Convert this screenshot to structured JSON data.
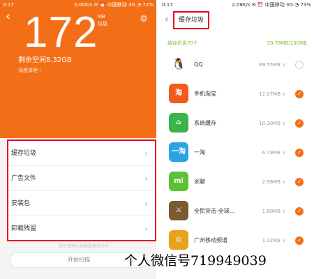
{
  "left": {
    "status": {
      "time": "0:17",
      "right": "0.00K/s ✉ ⏰ 中国移动 3G ◔ 72%"
    },
    "storage": {
      "value": "172",
      "unit": "MB",
      "unit_label": "垃圾",
      "remaining": "剩余空间8.32GB",
      "deep_clean": "深度清理 ›"
    },
    "menu": [
      {
        "label": "缓存垃圾"
      },
      {
        "label": "广告文件"
      },
      {
        "label": "安装包"
      },
      {
        "label": "卸载残留"
      }
    ],
    "hint": "部分清理大项需要等待文件",
    "start_button": "开始扫描"
  },
  "right": {
    "status": {
      "time": "0:17",
      "right": "2.08K/s ✉ ⏰ 中国移动 3G ◔ 73%"
    },
    "title": "缓存垃圾",
    "summary_left": "缓存垃圾70个",
    "summary_right": "39.78MB/130MB",
    "apps": [
      {
        "name": "QQ",
        "size": "89.55MB",
        "checked": false,
        "icon": "qq-icon",
        "color": "#ffffff",
        "glyph": "🐧"
      },
      {
        "name": "手机淘宝",
        "size": "12.07MB",
        "checked": true,
        "icon": "taobao-icon",
        "color": "#f35b1a",
        "glyph": "淘"
      },
      {
        "name": "系统缓存",
        "size": "10.30MB",
        "checked": true,
        "icon": "system-cache-icon",
        "color": "#39b54a",
        "glyph": "⌂"
      },
      {
        "name": "一淘",
        "size": "6.79MB",
        "checked": true,
        "icon": "yitao-icon",
        "color": "#2aa4e2",
        "glyph": "一淘"
      },
      {
        "name": "米聊",
        "size": "2.96MB",
        "checked": true,
        "icon": "miliao-icon",
        "color": "#5bc236",
        "glyph": "mi"
      },
      {
        "name": "全民突击-全球…",
        "size": "1.80MB",
        "checked": true,
        "icon": "game-icon",
        "color": "#7a5a2e",
        "glyph": "⚔"
      },
      {
        "name": "广州移动频道",
        "size": "1.42MB",
        "checked": true,
        "icon": "gz-mobile-icon",
        "color": "#e8a21b",
        "glyph": "◎"
      }
    ]
  },
  "watermark": "个人微信号719949039"
}
